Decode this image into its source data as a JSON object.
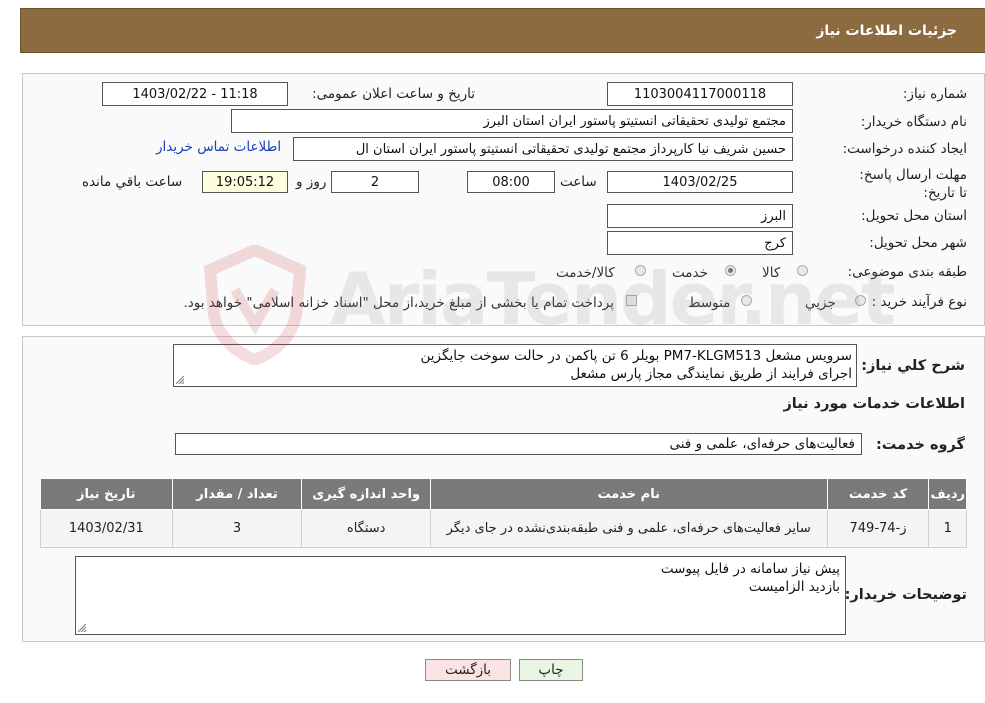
{
  "header": {
    "title": "جزئیات اطلاعات نیاز"
  },
  "need_info": {
    "need_number_label": "شماره نیاز:",
    "need_number": "1103004117000118",
    "announce_label": "تاریخ و ساعت اعلان عمومی:",
    "announce_value": "1403/02/22 - 11:18",
    "buyer_org_label": "نام دستگاه خریدار:",
    "buyer_org": "مجتمع تولیدی تحقیقاتی انستیتو پاستور ایران استان البرز",
    "creator_label": "ایجاد کننده درخواست:",
    "creator": "حسین شریف نیا کارپرداز مجتمع تولیدی تحقیقاتی انستیتو پاستور ایران استان ال",
    "contact_link": "اطلاعات تماس خریدار",
    "deadline_label": "مهلت ارسال پاسخ: تا تاریخ:",
    "deadline_date": "1403/02/25",
    "time_label": "ساعت",
    "deadline_time": "08:00",
    "days_value": "2",
    "days_label": "روز و",
    "remaining_time": "19:05:12",
    "remaining_label": "ساعت باقي مانده",
    "province_label": "استان محل تحویل:",
    "province": "البرز",
    "city_label": "شهر محل تحویل:",
    "city": "کرج",
    "category_label": "طبقه بندی موضوعی:",
    "category_options": [
      "کالا",
      "خدمت",
      "کالا/خدمت"
    ],
    "category_selected": "خدمت",
    "process_label": "نوع فرآیند خرید :",
    "process_options": [
      "جزیي",
      "متوسط"
    ],
    "process_selected": "",
    "payment_note": "پرداخت تمام یا بخشی از مبلغ خرید،از محل \"اسناد خزانه اسلامی\" خواهد بود."
  },
  "description": {
    "label": "شرح کلي نیاز:",
    "line1": "سرویس مشعل PM7-KLGM513 بویلر 6 تن پاکمن در حالت سوخت جایگزین",
    "line2": "اجرای فرایند از طریق نمایندگی مجاز پارس مشعل"
  },
  "services": {
    "section_title": "اطلاعات خدمات مورد نیاز",
    "group_label": "گروه خدمت:",
    "group_value": "فعالیت‌های حرفه‌ای، علمی و فنی",
    "columns": [
      "ردیف",
      "کد خدمت",
      "نام خدمت",
      "واحد اندازه گیری",
      "تعداد / مقدار",
      "تاریخ نیاز"
    ],
    "rows": [
      {
        "row": "1",
        "code": "ز-74-749",
        "name": "سایر فعالیت‌های حرفه‌ای، علمی و فنی طبقه‌بندی‌نشده در جای دیگر",
        "unit": "دستگاه",
        "qty": "3",
        "date": "1403/02/31"
      }
    ]
  },
  "buyer_notes": {
    "label": "توضیحات خریدار:",
    "line1": "پیش نیاز سامانه در فایل پیوست",
    "line2": "بازدید الزامیست"
  },
  "buttons": {
    "print": "چاپ",
    "back": "بازگشت"
  },
  "watermark": {
    "text": "AriaTender.net"
  },
  "colors": {
    "header_bg": "#8b6b3f",
    "link": "#1a3fbf",
    "table_header": "#7a7a7a",
    "back_btn": "#fbe3e3",
    "print_btn": "#eaf6e4"
  }
}
